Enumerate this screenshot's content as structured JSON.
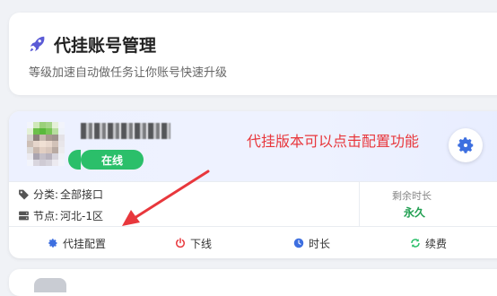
{
  "header": {
    "title": "代挂账号管理",
    "subtitle": "等级加速自动做任务让你账号快速升级",
    "icon": "rocket-icon",
    "accent": "#5b5bd6"
  },
  "account": {
    "status": "在线",
    "status_color": "#2bbf6a",
    "note": "代挂版本可以点击配置功能",
    "note_color": "#e8373c",
    "category_label": "分类:",
    "category_value": "全部接口",
    "node_label": "节点:",
    "node_value": "河北-1区",
    "remaining_label": "剩余时长",
    "remaining_value": "永久",
    "remaining_color": "#1e9e4f"
  },
  "actions": [
    {
      "label": "代挂配置",
      "icon": "gear-icon",
      "color": "#3d6fe0"
    },
    {
      "label": "下线",
      "icon": "power-icon",
      "color": "#e8373c"
    },
    {
      "label": "时长",
      "icon": "clock-icon",
      "color": "#3d6fe0"
    },
    {
      "label": "续费",
      "icon": "refresh-icon",
      "color": "#2bbf6a"
    }
  ]
}
